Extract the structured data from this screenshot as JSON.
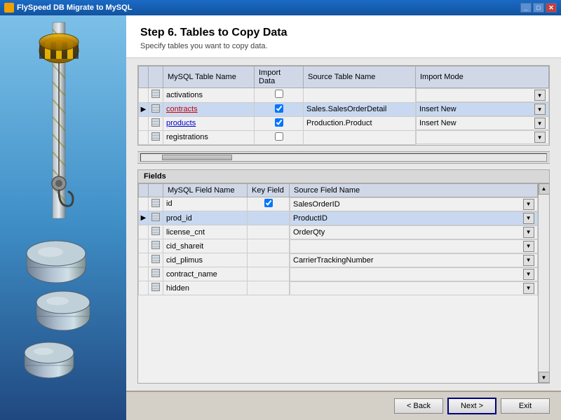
{
  "titlebar": {
    "title": "FlySpeed DB Migrate to MySQL",
    "controls": [
      "minimize",
      "maximize",
      "close"
    ]
  },
  "header": {
    "step_title": "Step 6. Tables to Copy Data",
    "step_subtitle": "Specify tables you want to copy data."
  },
  "tables_section": {
    "columns": [
      {
        "key": "mysql_name",
        "label": "MySQL Table Name"
      },
      {
        "key": "import_data",
        "label": "Import Data"
      },
      {
        "key": "source_name",
        "label": "Source Table Name"
      },
      {
        "key": "import_mode",
        "label": "Import Mode"
      }
    ],
    "rows": [
      {
        "id": "activations",
        "mysql_name": "activations",
        "name_style": "normal",
        "checked": false,
        "source_name": "",
        "import_mode": "",
        "active": false,
        "arrow": false
      },
      {
        "id": "contracts",
        "mysql_name": "contracts",
        "name_style": "red",
        "checked": true,
        "source_name": "Sales.SalesOrderDetail",
        "import_mode": "Insert New",
        "active": true,
        "arrow": true
      },
      {
        "id": "products",
        "mysql_name": "products",
        "name_style": "blue",
        "checked": true,
        "source_name": "Production.Product",
        "import_mode": "Insert New",
        "active": false,
        "arrow": false
      },
      {
        "id": "registrations",
        "mysql_name": "registrations",
        "name_style": "normal",
        "checked": false,
        "source_name": "",
        "import_mode": "",
        "active": false,
        "arrow": false
      }
    ]
  },
  "fields_section": {
    "label": "Fields",
    "columns": [
      {
        "key": "field_name",
        "label": "MySQL Field Name"
      },
      {
        "key": "key_field",
        "label": "Key Field"
      },
      {
        "key": "source_field",
        "label": "Source Field Name"
      }
    ],
    "rows": [
      {
        "id": "id",
        "field_name": "id",
        "key_field": true,
        "source_field": "SalesOrderID",
        "active": false,
        "arrow": false
      },
      {
        "id": "prod_id",
        "field_name": "prod_id",
        "key_field": false,
        "source_field": "ProductID",
        "active": true,
        "arrow": true
      },
      {
        "id": "license_cnt",
        "field_name": "license_cnt",
        "key_field": false,
        "source_field": "OrderQty",
        "active": false,
        "arrow": false
      },
      {
        "id": "cid_shareit",
        "field_name": "cid_shareit",
        "key_field": false,
        "source_field": "",
        "active": false,
        "arrow": false
      },
      {
        "id": "cid_plimus",
        "field_name": "cid_plimus",
        "key_field": false,
        "source_field": "CarrierTrackingNumber",
        "active": false,
        "arrow": false
      },
      {
        "id": "contract_name",
        "field_name": "contract_name",
        "key_field": false,
        "source_field": "",
        "active": false,
        "arrow": false
      },
      {
        "id": "hidden",
        "field_name": "hidden",
        "key_field": false,
        "source_field": "",
        "active": false,
        "arrow": false
      }
    ]
  },
  "footer": {
    "back_label": "< Back",
    "next_label": "Next >",
    "exit_label": "Exit"
  }
}
